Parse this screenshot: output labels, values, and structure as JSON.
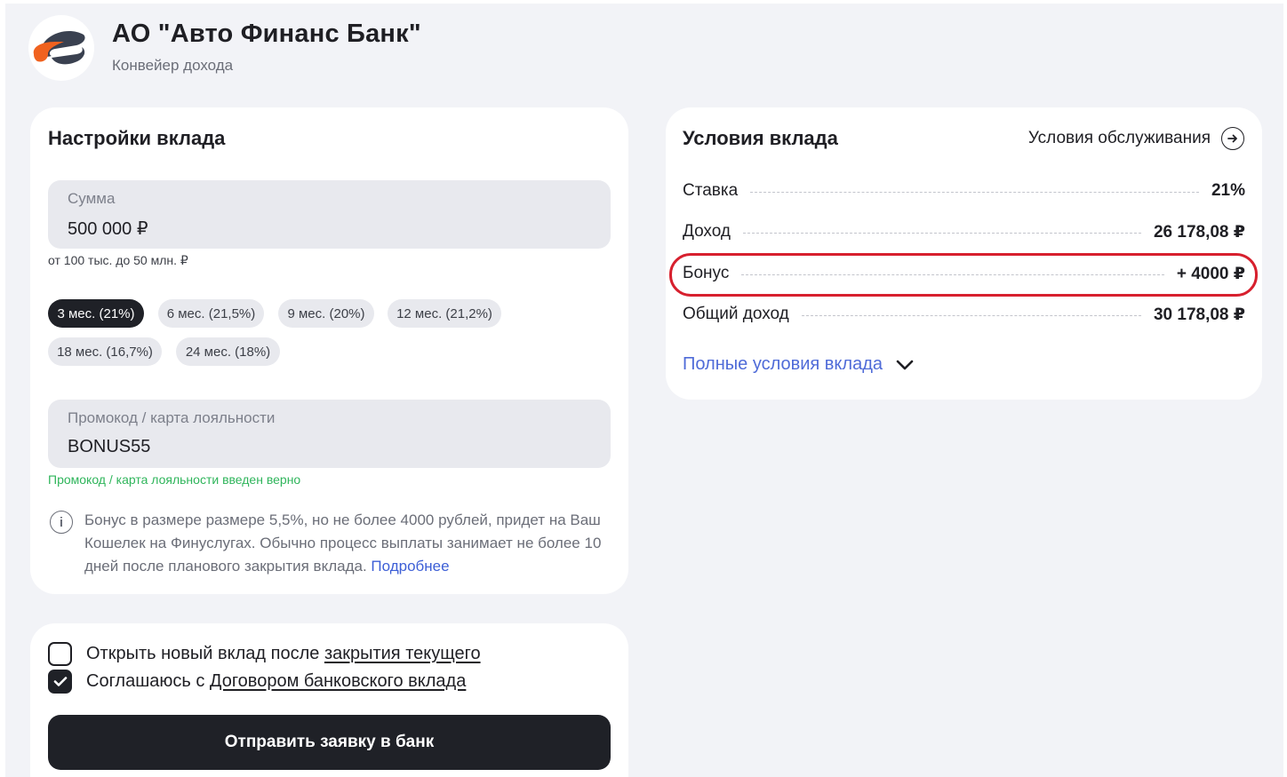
{
  "header": {
    "bank_name": "АО \"Авто Финанс Банк\"",
    "subtitle": "Конвейер дохода"
  },
  "settings": {
    "title": "Настройки вклада",
    "amount": {
      "label": "Сумма",
      "value": "500 000 ₽",
      "hint": "от 100 тыс. до 50 млн. ₽"
    },
    "terms": [
      {
        "label": "3 мес. (21%)",
        "active": true
      },
      {
        "label": "6 мес. (21,5%)",
        "active": false
      },
      {
        "label": "9 мес. (20%)",
        "active": false
      },
      {
        "label": "12 мес. (21,2%)",
        "active": false
      },
      {
        "label": "18 мес. (16,7%)",
        "active": false
      },
      {
        "label": "24 мес. (18%)",
        "active": false
      }
    ],
    "promo": {
      "label": "Промокод / карта лояльности",
      "value": "BONUS55",
      "status": "Промокод / карта лояльности введен верно"
    },
    "info": {
      "text": "Бонус в размере размере 5,5%, но не более 4000 рублей, придет на Ваш Кошелек на Финуслугах. Обычно процесс выплаты занимает не более 10 дней после планового закрытия вклада.",
      "link": "Подробнее"
    }
  },
  "conditions": {
    "title": "Условия вклада",
    "service_link": "Условия обслуживания",
    "rows": [
      {
        "label": "Ставка",
        "value": "21%"
      },
      {
        "label": "Доход",
        "value": "26 178,08 ₽"
      },
      {
        "label": "Бонус",
        "value": "+ 4000 ₽"
      },
      {
        "label": "Общий доход",
        "value": "30 178,08 ₽"
      }
    ],
    "full_terms": "Полные условия вклада"
  },
  "submit": {
    "reopen_prefix": "Открыть новый вклад после",
    "reopen_link": "закрытия текущего",
    "reopen_checked": false,
    "agree_prefix": "Соглашаюсь с",
    "agree_link": "Договором банковского вклада",
    "agree_checked": true,
    "button": "Отправить заявку в банк"
  },
  "colors": {
    "accent_dark": "#1f2127",
    "link_blue": "#4f6bd8",
    "success_green": "#2fb55b",
    "highlight_red": "#d7202e",
    "logo_orange": "#f0621f",
    "logo_dark": "#3a4150"
  }
}
